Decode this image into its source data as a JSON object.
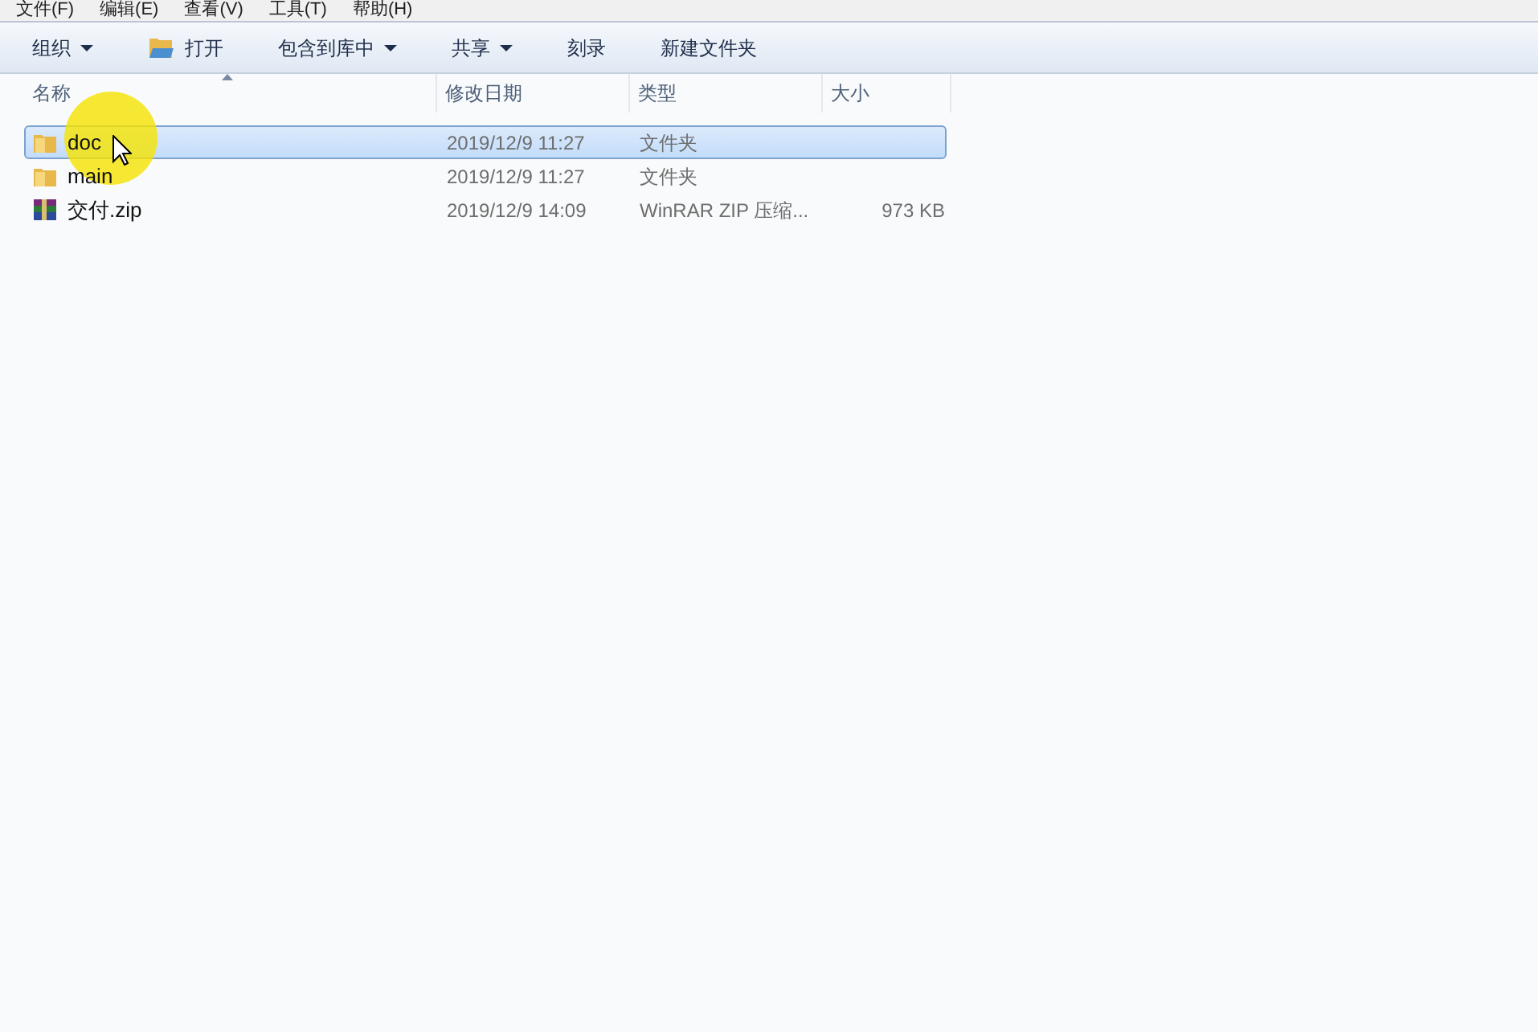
{
  "menu_bar": [
    "文件(F)",
    "编辑(E)",
    "查看(V)",
    "工具(T)",
    "帮助(H)"
  ],
  "toolbar": [
    {
      "label": "组织",
      "kind": "dropdown"
    },
    {
      "label": "打开",
      "kind": "open"
    },
    {
      "label": "包含到库中",
      "kind": "dropdown"
    },
    {
      "label": "共享",
      "kind": "dropdown"
    },
    {
      "label": "刻录",
      "kind": "plain"
    },
    {
      "label": "新建文件夹",
      "kind": "plain"
    }
  ],
  "table": {
    "columns": [
      "名称",
      "修改日期",
      "类型",
      "大小"
    ],
    "rows": [
      {
        "name": "doc",
        "date": "2019/12/9 11:27",
        "type": "文件夹",
        "size": "",
        "kind": "folder",
        "selected": true
      },
      {
        "name": "main",
        "date": "2019/12/9 11:27",
        "type": "文件夹",
        "size": "",
        "kind": "folder",
        "selected": false
      },
      {
        "name": "交付.zip",
        "date": "2019/12/9 14:09",
        "type": "WinRAR ZIP 压缩...",
        "size": "973 KB",
        "kind": "archive",
        "selected": false
      }
    ]
  }
}
